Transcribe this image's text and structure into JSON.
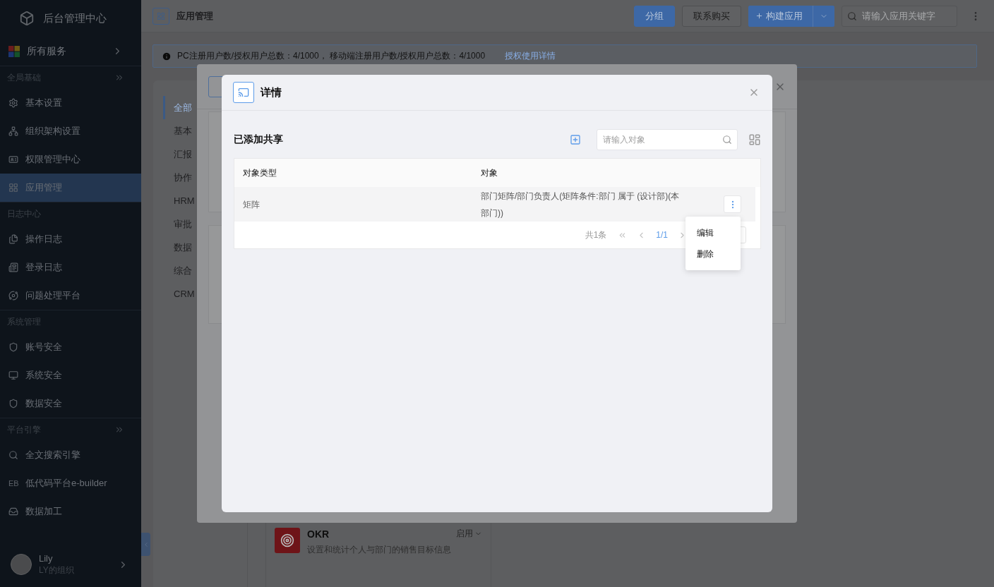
{
  "sidebar": {
    "title": "后台管理中心",
    "all_services": "所有服务",
    "sections": [
      {
        "label": "全局基础",
        "expandable": true,
        "items": [
          {
            "label": "基本设置",
            "selected": false
          },
          {
            "label": "组织架构设置",
            "selected": false
          },
          {
            "label": "权限管理中心",
            "selected": false
          },
          {
            "label": "应用管理",
            "selected": true
          }
        ]
      },
      {
        "label": "日志中心",
        "expandable": false,
        "items": [
          {
            "label": "操作日志",
            "selected": false
          },
          {
            "label": "登录日志",
            "selected": false
          },
          {
            "label": "问题处理平台",
            "selected": false
          }
        ]
      },
      {
        "label": "系统管理",
        "expandable": false,
        "items": [
          {
            "label": "账号安全",
            "selected": false
          },
          {
            "label": "系统安全",
            "selected": false
          },
          {
            "label": "数据安全",
            "selected": false
          }
        ]
      },
      {
        "label": "平台引擎",
        "expandable": true,
        "items": [
          {
            "label": "全文搜索引擎",
            "selected": false
          },
          {
            "label": "低代码平台e-builder",
            "selected": false,
            "badge": "EB"
          },
          {
            "label": "数据加工",
            "selected": false
          }
        ]
      }
    ],
    "user": {
      "name": "Lily",
      "org": "LY的组织"
    }
  },
  "header": {
    "title": "应用管理",
    "buttons": [
      {
        "label": "分组",
        "kind": "primary"
      },
      {
        "label": "联系购买",
        "kind": "default"
      },
      {
        "label": "构建应用",
        "kind": "split"
      }
    ],
    "search": {
      "placeholder": "请输入应用关键字"
    }
  },
  "notice": {
    "text": "PC注册用户数/授权用户总数：4/1000， 移动端注册用户数/授权用户总数：4/1000",
    "link": "授权使用详情"
  },
  "categories": [
    {
      "label": "全部",
      "selected": true
    },
    {
      "label": "基本",
      "selected": false
    },
    {
      "label": "汇报",
      "selected": false
    },
    {
      "label": "协作",
      "selected": false
    },
    {
      "label": "HRM",
      "selected": false
    },
    {
      "label": "审批",
      "selected": false
    },
    {
      "label": "数据",
      "selected": false
    },
    {
      "label": "综合",
      "selected": false
    },
    {
      "label": "CRM",
      "selected": false
    }
  ],
  "app_card": {
    "name": "OKR",
    "status": "启用",
    "description": "设置和统计个人与部门的销售目标信息"
  },
  "dialog": {
    "title": "详情",
    "section_title": "已添加共享",
    "search": {
      "placeholder": "请输入对象"
    },
    "table": {
      "columns": [
        "对象类型",
        "对象"
      ],
      "rows": [
        {
          "cells": [
            "矩阵",
            "部门矩阵/部门负责人(矩阵条件:部门 属于 (设计部)(本部门))"
          ],
          "hovered": true
        }
      ]
    },
    "pagination": {
      "total": "共1条",
      "page": "1/1"
    },
    "menu": {
      "items": [
        "编辑",
        "删除"
      ]
    }
  }
}
